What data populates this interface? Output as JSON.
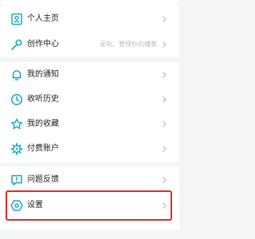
{
  "accent_color": "#16a9c5",
  "highlight_color": "#e22b1f",
  "groups": [
    {
      "items": [
        {
          "label": "个人主页",
          "icon": "profile-card-icon",
          "hint": ""
        },
        {
          "label": "创作中心",
          "icon": "mic-icon",
          "hint": "录制、管理你的播客"
        }
      ]
    },
    {
      "items": [
        {
          "label": "我的通知",
          "icon": "bell-icon",
          "hint": ""
        },
        {
          "label": "收听历史",
          "icon": "clock-icon",
          "hint": ""
        },
        {
          "label": "我的收藏",
          "icon": "star-icon",
          "hint": ""
        },
        {
          "label": "付费账户",
          "icon": "gear-wallet-icon",
          "hint": ""
        }
      ]
    },
    {
      "items": [
        {
          "label": "问题反馈",
          "icon": "feedback-icon",
          "hint": ""
        },
        {
          "label": "设置",
          "icon": "settings-icon",
          "hint": ""
        }
      ]
    }
  ]
}
